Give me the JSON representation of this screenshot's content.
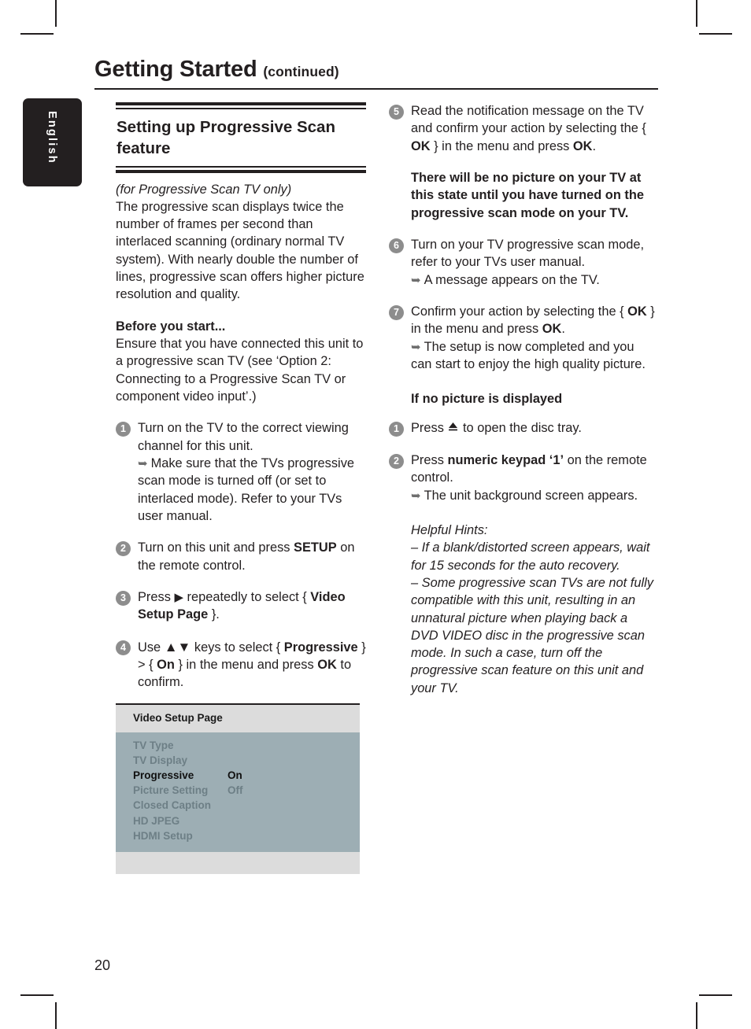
{
  "crop_marks": true,
  "header": {
    "title": "Getting Started",
    "continued": "(continued)"
  },
  "language_tab": {
    "label": "English"
  },
  "page_number": "20",
  "left_column": {
    "section_title": "Setting up Progressive Scan feature",
    "intro_italic": "(for Progressive Scan TV only)",
    "intro_body": "The progressive scan displays twice the number of frames per second than interlaced scanning (ordinary normal TV system). With nearly double the number of lines, progressive scan offers higher picture resolution and quality.",
    "before_heading": "Before you start...",
    "before_body": "Ensure that you have connected this unit to a progressive scan TV (see ‘Option 2: Connecting to a Progressive Scan TV or component video input’.)",
    "steps": [
      {
        "num": "1",
        "text": "Turn on the TV to the correct viewing channel for this unit.",
        "sub": "Make sure that the TVs progressive scan mode is turned off (or set to interlaced mode). Refer to your TVs user manual."
      },
      {
        "num": "2",
        "text_pre": "Turn on this unit and press ",
        "text_bold": "SETUP",
        "text_post": " on the remote control."
      },
      {
        "num": "3",
        "text_pre": "Press ",
        "glyph": "▶",
        "text_mid": " repeatedly to select { ",
        "text_bold": "Video Setup Page",
        "text_post": " }."
      },
      {
        "num": "4",
        "text_pre": "Use ",
        "glyph": "▲▼",
        "text_mid": " keys to select { ",
        "text_bold": "Progressive",
        "text_mid2": " } > { ",
        "text_bold2": "On",
        "text_mid3": " } in the menu and press ",
        "text_bold3": "OK",
        "text_post": " to confirm."
      }
    ],
    "menu": {
      "title": "Video Setup Page",
      "rows": [
        {
          "label": "TV Type",
          "value": "",
          "active": false
        },
        {
          "label": "TV Display",
          "value": "",
          "active": false
        },
        {
          "label": "Progressive",
          "value": "On",
          "active": true
        },
        {
          "label": "Picture Setting",
          "value": "Off",
          "active": false
        },
        {
          "label": "Closed Caption",
          "value": "",
          "active": false
        },
        {
          "label": "HD JPEG",
          "value": "",
          "active": false
        },
        {
          "label": "HDMI Setup",
          "value": "",
          "active": false
        }
      ],
      "colors": {
        "header_bg": "#dcdcdc",
        "body_bg": "#9daeb4",
        "active_text": "#101010",
        "dim_text": "#6d7f86"
      }
    }
  },
  "right_column": {
    "steps": [
      {
        "num": "5",
        "text_pre": "Read the notification message on the TV and confirm your action by selecting the { ",
        "text_bold": "OK",
        "text_mid": " } in the menu and press ",
        "text_bold2": "OK",
        "text_post": "."
      },
      {
        "num": "6",
        "text": "Turn on your TV progressive scan mode, refer to your TVs user manual.",
        "sub": "A message appears on the TV."
      },
      {
        "num": "7",
        "text_pre": "Confirm your action by selecting the { ",
        "text_bold": "OK",
        "text_mid": " } in the menu and press ",
        "text_bold2": "OK",
        "text_post": ".",
        "sub": "The setup is now completed and you can start to enjoy the high quality picture."
      }
    ],
    "warning": "There will be no picture on your TV at this state until you have turned on the progressive scan mode on your TV.",
    "no_picture_heading": "If no picture is displayed",
    "no_picture_steps": [
      {
        "num": "1",
        "text_pre": "Press ",
        "glyph": "eject-icon",
        "text_post": " to open the disc tray."
      },
      {
        "num": "2",
        "text_pre": "Press ",
        "text_bold": "numeric keypad ‘1’",
        "text_post": " on the remote control.",
        "sub": "The unit background screen appears."
      }
    ],
    "hints_heading": "Helpful Hints:",
    "hints": [
      "–  If a blank/distorted screen appears, wait for 15 seconds for the auto recovery.",
      "–  Some progressive scan TVs are not fully compatible with this unit, resulting in an unnatural picture when playing back a DVD VIDEO disc in the progressive scan mode. In such a case, turn off the progressive scan feature on this unit and your TV."
    ]
  }
}
